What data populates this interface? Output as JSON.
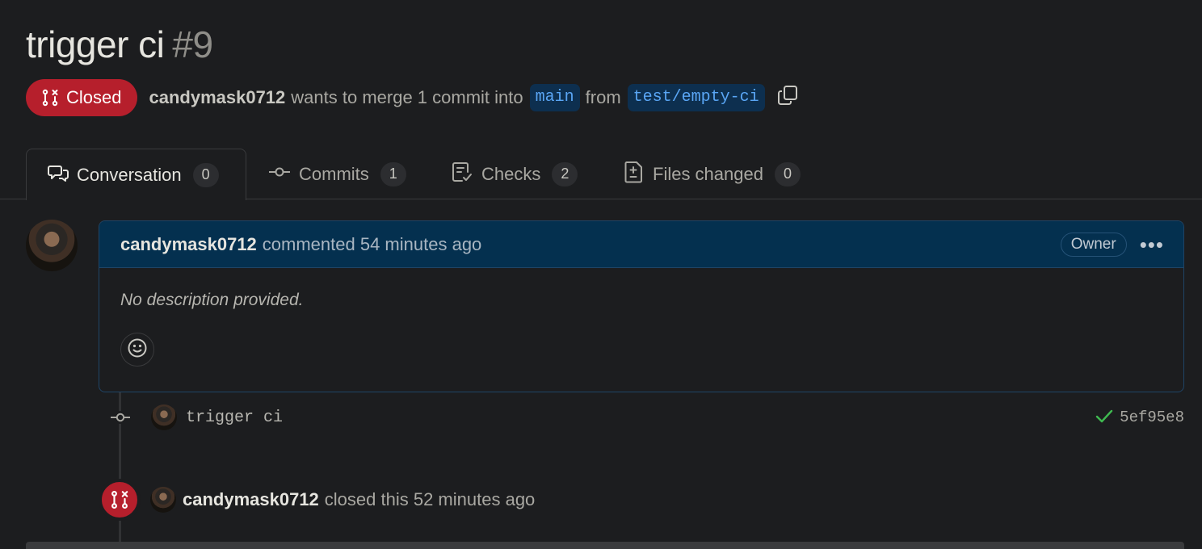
{
  "pr": {
    "title": "trigger ci",
    "number": "#9",
    "state": "Closed",
    "author": "candymask0712",
    "merge_text": "wants to merge 1 commit into",
    "base_branch": "main",
    "from_text": "from",
    "head_branch": "test/empty-ci"
  },
  "tabs": [
    {
      "label": "Conversation",
      "count": "0",
      "icon": "comment-discussion-icon"
    },
    {
      "label": "Commits",
      "count": "1",
      "icon": "git-commit-icon"
    },
    {
      "label": "Checks",
      "count": "2",
      "icon": "checklist-icon"
    },
    {
      "label": "Files changed",
      "count": "0",
      "icon": "file-diff-icon"
    }
  ],
  "comment": {
    "author": "candymask0712",
    "action": "commented 54 minutes ago",
    "role": "Owner",
    "body": "No description provided."
  },
  "commit": {
    "message": "trigger ci",
    "sha": "5ef95e8",
    "status": "success"
  },
  "closed_event": {
    "author": "candymask0712",
    "text": "closed this 52 minutes ago"
  },
  "colors": {
    "closed_red": "#b61f2c",
    "branch_blue": "#5aa6f5",
    "comment_header": "#04304f",
    "success_green": "#3fb950"
  }
}
